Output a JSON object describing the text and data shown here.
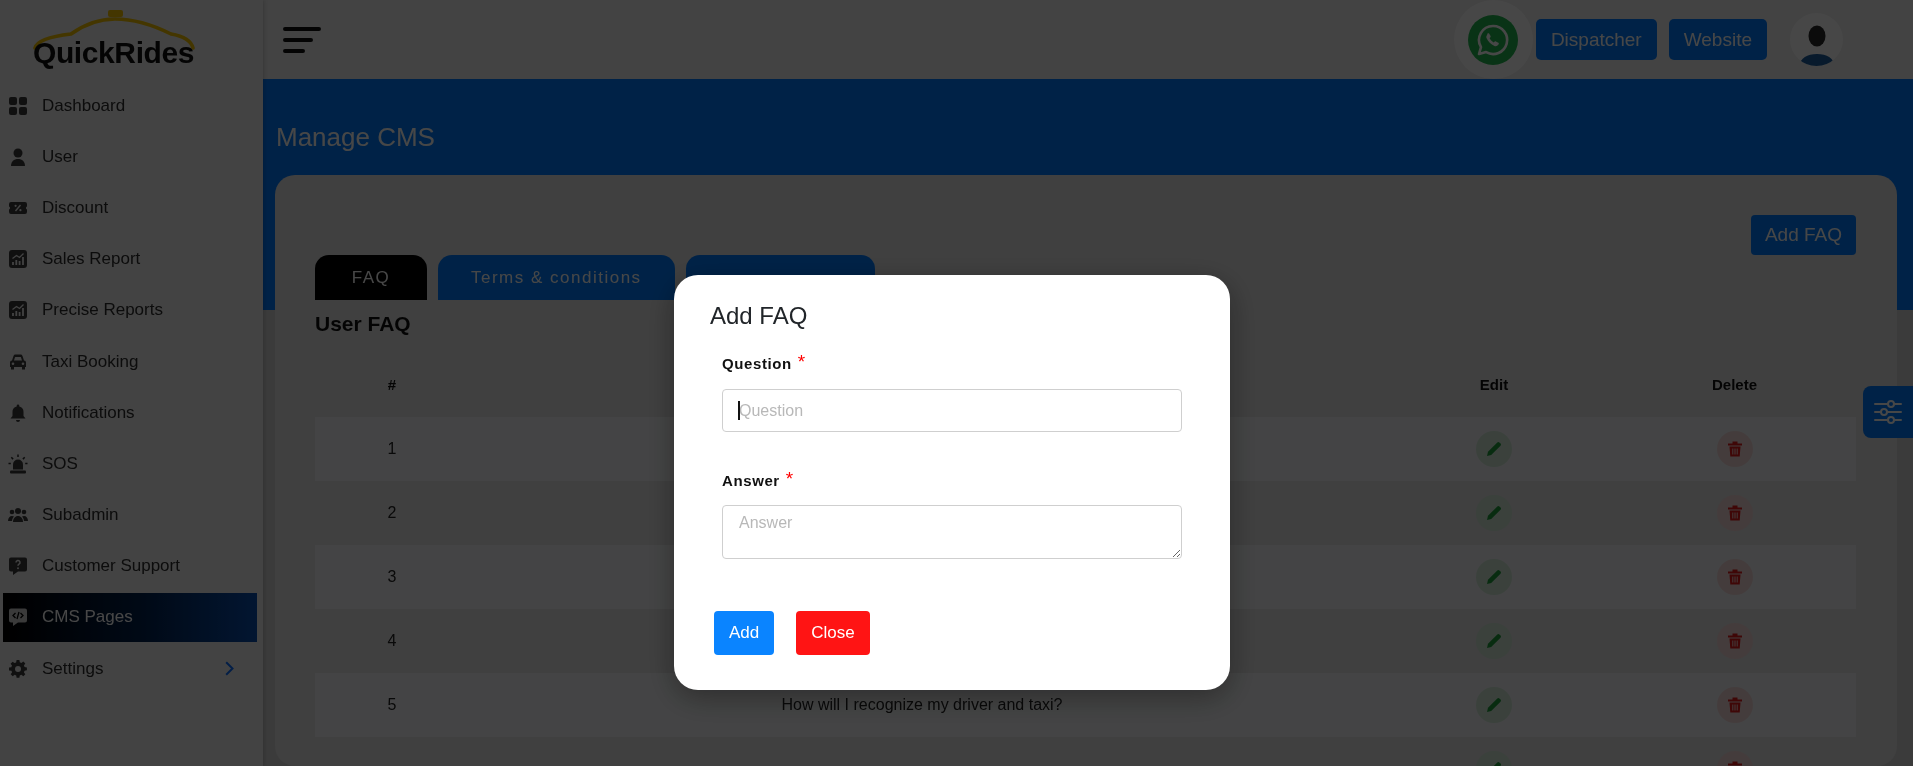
{
  "logo": {
    "text": "QuickRides"
  },
  "sidebar": {
    "items": [
      {
        "label": "Dashboard",
        "selected": false,
        "submenu": false
      },
      {
        "label": "User",
        "selected": false,
        "submenu": false
      },
      {
        "label": "Discount",
        "selected": false,
        "submenu": false
      },
      {
        "label": "Sales Report",
        "selected": false,
        "submenu": false
      },
      {
        "label": "Precise Reports",
        "selected": false,
        "submenu": false
      },
      {
        "label": "Taxi Booking",
        "selected": false,
        "submenu": false
      },
      {
        "label": "Notifications",
        "selected": false,
        "submenu": false
      },
      {
        "label": "SOS",
        "selected": false,
        "submenu": false
      },
      {
        "label": "Subadmin",
        "selected": false,
        "submenu": false
      },
      {
        "label": "Customer Support",
        "selected": false,
        "submenu": false
      },
      {
        "label": "CMS Pages",
        "selected": true,
        "submenu": false
      },
      {
        "label": "Settings",
        "selected": false,
        "submenu": true
      }
    ]
  },
  "header": {
    "buttons": [
      "Dispatcher",
      "Website"
    ]
  },
  "page": {
    "title": "Manage CMS",
    "action_button": "Add FAQ",
    "tabs": [
      {
        "label": "FAQ",
        "selected": true
      },
      {
        "label": "Terms & conditions",
        "selected": false
      },
      {
        "selected": false
      }
    ],
    "section_title": "User FAQ",
    "table": {
      "columns": [
        {
          "kind": "number",
          "label": "#"
        },
        {
          "kind": "text"
        },
        {
          "kind": "edit",
          "label": "Edit"
        },
        {
          "kind": "delete",
          "label": "Delete"
        }
      ],
      "rows": [
        {
          "number": "1"
        },
        {
          "number": "2"
        },
        {
          "number": "3"
        },
        {
          "number": "4"
        },
        {
          "number": "5",
          "question": "How will I recognize my driver and taxi?"
        },
        {}
      ]
    }
  },
  "modal": {
    "title": "Add FAQ",
    "fields": [
      {
        "kind": "input",
        "label": "Question",
        "required_mark": "*",
        "placeholder": "Question",
        "focused": true
      },
      {
        "kind": "textarea",
        "label": "Answer",
        "required_mark": "*",
        "placeholder": "Answer",
        "focused": false
      }
    ],
    "buttons": [
      {
        "kind": "primary",
        "label": "Add"
      },
      {
        "kind": "danger",
        "label": "Close"
      }
    ]
  }
}
